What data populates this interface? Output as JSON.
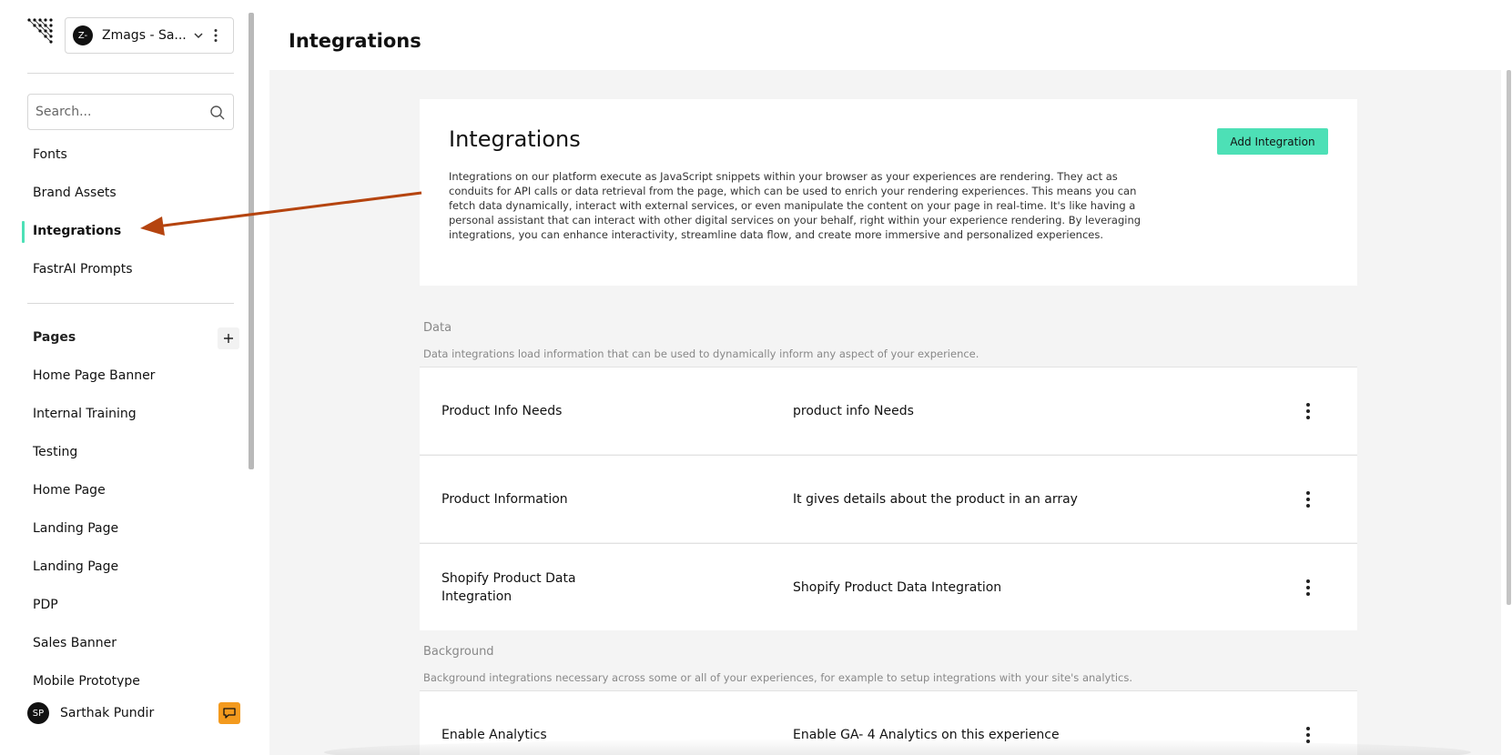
{
  "org": {
    "avatar_text": "Z-",
    "name": "Zmags - Sa..."
  },
  "search": {
    "placeholder": "Search..."
  },
  "sidebar": {
    "items": [
      {
        "label": "Fonts"
      },
      {
        "label": "Brand Assets"
      },
      {
        "label": "Integrations",
        "active": true
      },
      {
        "label": "FastrAI Prompts"
      }
    ],
    "pages_title": "Pages",
    "pages": [
      "Home Page Banner",
      "Internal Training",
      "Testing",
      "Home Page",
      "Landing Page",
      "Landing Page",
      "PDP",
      "Sales Banner",
      "Mobile Prototype"
    ]
  },
  "user": {
    "initials": "SP",
    "name": "Sarthak Pundir"
  },
  "header": {
    "title": "Integrations"
  },
  "intro": {
    "title": "Integrations",
    "add_button": "Add Integration",
    "description": "Integrations on our platform execute as JavaScript snippets within your browser as your experiences are rendering. They act as conduits for API calls or data retrieval from the page, which can be used to enrich your rendering experiences. This means you can fetch data dynamically, interact with external services, or even manipulate the content on your page in real-time. It's like having a personal assistant that can interact with other digital services on your behalf, right within your experience rendering. By leveraging integrations, you can enhance interactivity, streamline data flow, and create more immersive and personalized experiences."
  },
  "sections": {
    "data": {
      "title": "Data",
      "subtitle": "Data integrations load information that can be used to dynamically inform any aspect of your experience.",
      "rows": [
        {
          "name": "Product Info Needs",
          "description": "product info Needs"
        },
        {
          "name": "Product Information",
          "description": "It gives details about the product in an array"
        },
        {
          "name": "Shopify Product Data Integration",
          "description": "Shopify Product Data Integration"
        }
      ]
    },
    "background": {
      "title": "Background",
      "subtitle": "Background integrations necessary across some or all of your experiences, for example to setup integrations with your site's analytics.",
      "rows": [
        {
          "name": "Enable Analytics",
          "description": "Enable GA- 4 Analytics on this experience"
        }
      ]
    }
  },
  "colors": {
    "accent": "#4de0b6",
    "chat": "#f39a1e",
    "annotation_arrow": "#b5440f"
  }
}
